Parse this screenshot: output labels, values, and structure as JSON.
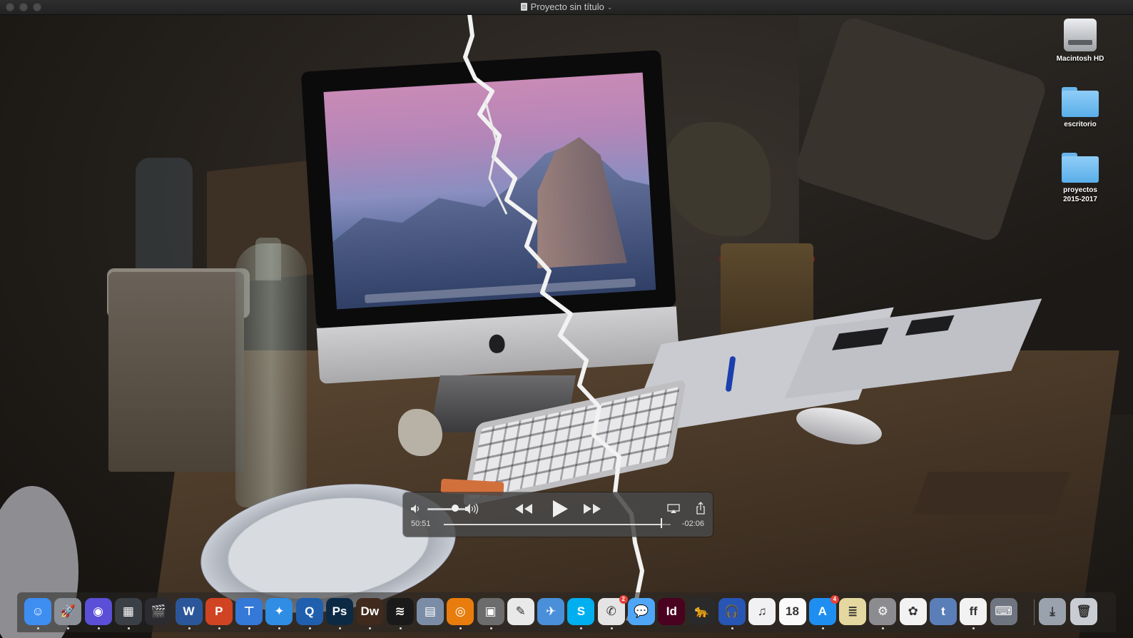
{
  "window": {
    "title": "Proyecto sin título",
    "title_chevron": "⌄"
  },
  "desktop_icons": [
    {
      "label": "Macintosh HD",
      "icon": "hard-drive-icon"
    },
    {
      "label": "escritorio",
      "icon": "folder-icon"
    },
    {
      "label": "proyectos\n2015-2017",
      "icon": "folder-icon"
    }
  ],
  "player": {
    "elapsed": "50:51",
    "remaining": "-02:06",
    "progress": 0.96,
    "volume": 0.72,
    "icons": {
      "volume_low": "volume-low-icon",
      "volume_high": "volume-high-icon",
      "rewind": "rewind-icon",
      "play": "play-icon",
      "fast_forward": "fast-forward-icon",
      "airplay": "airplay-icon",
      "share": "share-icon"
    }
  },
  "dock": {
    "apps": [
      {
        "name": "finder",
        "glyph": "☺",
        "color": "#3e8ef2"
      },
      {
        "name": "launchpad",
        "glyph": "🚀",
        "color": "#8a8f98"
      },
      {
        "name": "siri",
        "glyph": "◉",
        "color": "#5a4fd6"
      },
      {
        "name": "mission-control",
        "glyph": "▦",
        "color": "#3b3f46"
      },
      {
        "name": "final-cut-pro",
        "glyph": "🎬",
        "color": "#2c2c30"
      },
      {
        "name": "word",
        "glyph": "W",
        "color": "#2b579a"
      },
      {
        "name": "powerpoint",
        "glyph": "P",
        "color": "#d04423"
      },
      {
        "name": "keynote",
        "glyph": "⊤",
        "color": "#3478d8"
      },
      {
        "name": "safari",
        "glyph": "✦",
        "color": "#2f8de4"
      },
      {
        "name": "quicktime",
        "glyph": "Q",
        "color": "#1f5fae"
      },
      {
        "name": "photoshop",
        "glyph": "Ps",
        "color": "#0c2a44"
      },
      {
        "name": "dreamweaver",
        "glyph": "Dw",
        "color": "#3f2a1d"
      },
      {
        "name": "spotify",
        "glyph": "≋",
        "color": "#1a1a1a"
      },
      {
        "name": "preview",
        "glyph": "▤",
        "color": "#7b8da6"
      },
      {
        "name": "blender",
        "glyph": "◎",
        "color": "#e87d0d"
      },
      {
        "name": "photo-booth",
        "glyph": "▣",
        "color": "#6c6c6c"
      },
      {
        "name": "textedit",
        "glyph": "✎",
        "color": "#e9e9e9"
      },
      {
        "name": "mail",
        "glyph": "✈",
        "color": "#4a8fd9"
      },
      {
        "name": "skype",
        "glyph": "S",
        "color": "#00aff0"
      },
      {
        "name": "facetime",
        "glyph": "✆",
        "color": "#e4e4e4",
        "badge": "2"
      },
      {
        "name": "messages",
        "glyph": "💬",
        "color": "#4fa6f6"
      },
      {
        "name": "indesign",
        "glyph": "Id",
        "color": "#49021f"
      },
      {
        "name": "cheetah-app",
        "glyph": "🐆",
        "color": "#2a2a2a"
      },
      {
        "name": "audacity",
        "glyph": "🎧",
        "color": "#2856b5"
      },
      {
        "name": "itunes",
        "glyph": "♫",
        "color": "#f1f1f3"
      },
      {
        "name": "calendar",
        "glyph": "18",
        "color": "#fafafa"
      },
      {
        "name": "app-store",
        "glyph": "A",
        "color": "#1e8ff0",
        "badge": "4"
      },
      {
        "name": "notes",
        "glyph": "≣",
        "color": "#e4d8a0"
      },
      {
        "name": "system-preferences",
        "glyph": "⚙",
        "color": "#8c8c90"
      },
      {
        "name": "photos",
        "glyph": "✿",
        "color": "#f2f2f2"
      },
      {
        "name": "typeface",
        "glyph": "t",
        "color": "#5a7fb8"
      },
      {
        "name": "fontlab",
        "glyph": "ff",
        "color": "#f2f2f2"
      },
      {
        "name": "remote-desktop",
        "glyph": "⌨",
        "color": "#6f7580"
      }
    ],
    "trailing": [
      {
        "name": "downloads-stack",
        "glyph": "⤓",
        "color": "#9aa3ad"
      },
      {
        "name": "trash",
        "glyph": "🗑",
        "color": "#c9cdd3"
      }
    ],
    "running_indicators": [
      0,
      1,
      2,
      3,
      5,
      6,
      7,
      8,
      9,
      10,
      11,
      12,
      14,
      15,
      18,
      19,
      23,
      26,
      28,
      31
    ]
  },
  "colors": {
    "folder_blue": "#5aaee9",
    "hud_background": "#484848"
  }
}
